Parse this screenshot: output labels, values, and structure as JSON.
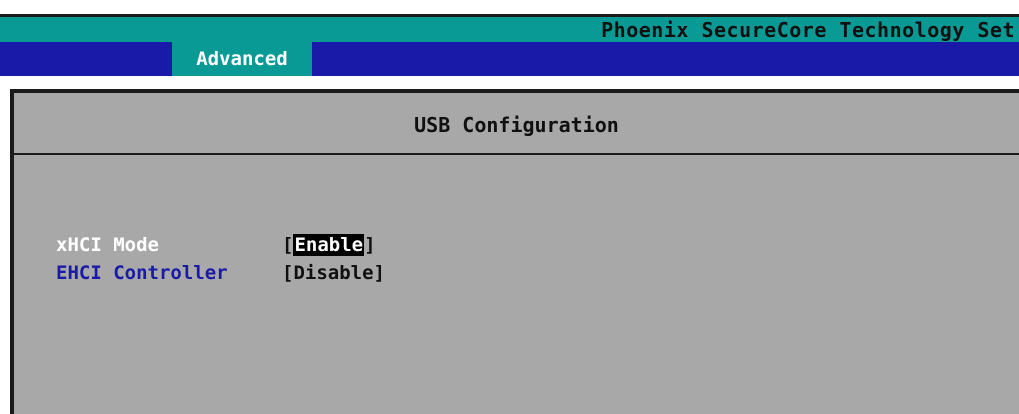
{
  "header": {
    "product_title": "Phoenix SecureCore Technology Set"
  },
  "tabs": [
    {
      "label": "Advanced",
      "active": true
    }
  ],
  "panel": {
    "title": "USB Configuration"
  },
  "settings": [
    {
      "label": "xHCI Mode",
      "value": "Enable",
      "selected": true
    },
    {
      "label": "EHCI Controller",
      "value": "Disable",
      "selected": false
    }
  ],
  "colors": {
    "title_bar": "#0a9a96",
    "tab_bar": "#1a1aa8",
    "panel_bg": "#a8a8a8",
    "highlight": "#000000",
    "label_blue": "#1a1aa8"
  }
}
